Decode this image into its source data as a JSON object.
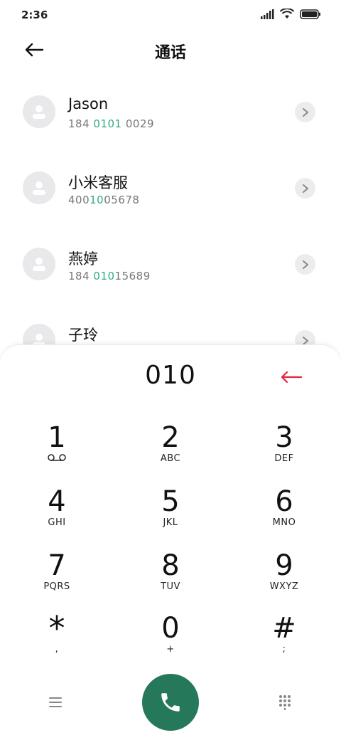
{
  "status_bar": {
    "time": "2:36"
  },
  "header": {
    "title": "通话"
  },
  "contacts": [
    {
      "name": "Jason",
      "number_parts": [
        "184 ",
        "0101",
        " 0029"
      ]
    },
    {
      "name": "小米客服",
      "number_parts": [
        "400",
        "10",
        "05678"
      ]
    },
    {
      "name": "燕婷",
      "number_parts": [
        "184 ",
        "010",
        "15689"
      ]
    },
    {
      "name": "子玲",
      "number_parts": [
        "",
        "",
        ""
      ]
    }
  ],
  "dialpad": {
    "display": "010",
    "keys": [
      {
        "digit": "1",
        "sub": "voicemail"
      },
      {
        "digit": "2",
        "sub": "ABC"
      },
      {
        "digit": "3",
        "sub": "DEF"
      },
      {
        "digit": "4",
        "sub": "GHI"
      },
      {
        "digit": "5",
        "sub": "JKL"
      },
      {
        "digit": "6",
        "sub": "MNO"
      },
      {
        "digit": "7",
        "sub": "PQRS"
      },
      {
        "digit": "8",
        "sub": "TUV"
      },
      {
        "digit": "9",
        "sub": "WXYZ"
      },
      {
        "digit": "*",
        "sub": ","
      },
      {
        "digit": "0",
        "sub": "+"
      },
      {
        "digit": "#",
        "sub": ";"
      }
    ]
  },
  "colors": {
    "accent_green": "#2fae7f",
    "call_button": "#25795a",
    "backspace_red": "#e2243f"
  },
  "icons": {
    "back": "arrow-left-icon",
    "backspace": "backspace-arrow-icon",
    "menu": "hamburger-icon",
    "call": "phone-icon",
    "grid": "dialpad-grid-icon"
  }
}
